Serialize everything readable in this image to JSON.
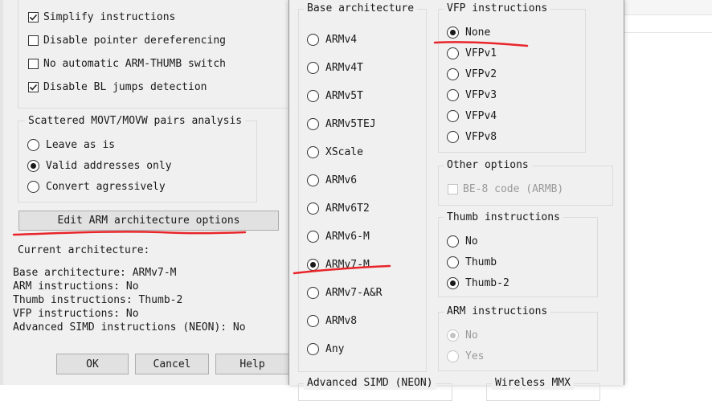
{
  "left_dialog": {
    "options": [
      {
        "label": "Simplify instructions",
        "checked": true
      },
      {
        "label": "Disable pointer dereferencing",
        "checked": false
      },
      {
        "label": "No automatic ARM-THUMB switch",
        "checked": false
      },
      {
        "label": "Disable BL jumps detection",
        "checked": true
      }
    ],
    "movt_group": {
      "title": "Scattered MOVT/MOVW pairs analysis",
      "options": [
        {
          "label": "Leave as is",
          "selected": false
        },
        {
          "label": "Valid addresses only",
          "selected": true
        },
        {
          "label": "Convert agressively",
          "selected": false
        }
      ]
    },
    "edit_button": "Edit ARM architecture options",
    "current_title": "Current architecture:",
    "current_lines": [
      "Base architecture: ARMv7-M",
      "ARM instructions: No",
      "Thumb instructions: Thumb-2",
      "VFP instructions: No",
      "Advanced SIMD instructions (NEON): No"
    ],
    "buttons": {
      "ok": "OK",
      "cancel": "Cancel",
      "help": "Help"
    }
  },
  "arch_dialog": {
    "base": {
      "title": "Base architecture",
      "options": [
        "ARMv4",
        "ARMv4T",
        "ARMv5T",
        "ARMv5TEJ",
        "XScale",
        "ARMv6",
        "ARMv6T2",
        "ARMv6-M",
        "ARMv7-M",
        "ARMv7-A&R",
        "ARMv8",
        "Any"
      ],
      "selected": "ARMv7-M"
    },
    "vfp": {
      "title": "VFP instructions",
      "options": [
        "None",
        "VFPv1",
        "VFPv2",
        "VFPv3",
        "VFPv4",
        "VFPv8"
      ],
      "selected": "None"
    },
    "other": {
      "title": "Other options",
      "be8_label": "BE-8 code (ARMB)",
      "be8_checked": false
    },
    "thumb": {
      "title": "Thumb instructions",
      "options": [
        "No",
        "Thumb",
        "Thumb-2"
      ],
      "selected": "Thumb-2"
    },
    "arm": {
      "title": "ARM instructions",
      "options": [
        "No",
        "Yes"
      ],
      "selected": "No"
    },
    "bottom_titles": [
      "Advanced SIMD (NEON)",
      "Wireless MMX"
    ]
  },
  "colors": {
    "annotation": "#e8252a",
    "dialog_bg": "#f0f0f0"
  }
}
